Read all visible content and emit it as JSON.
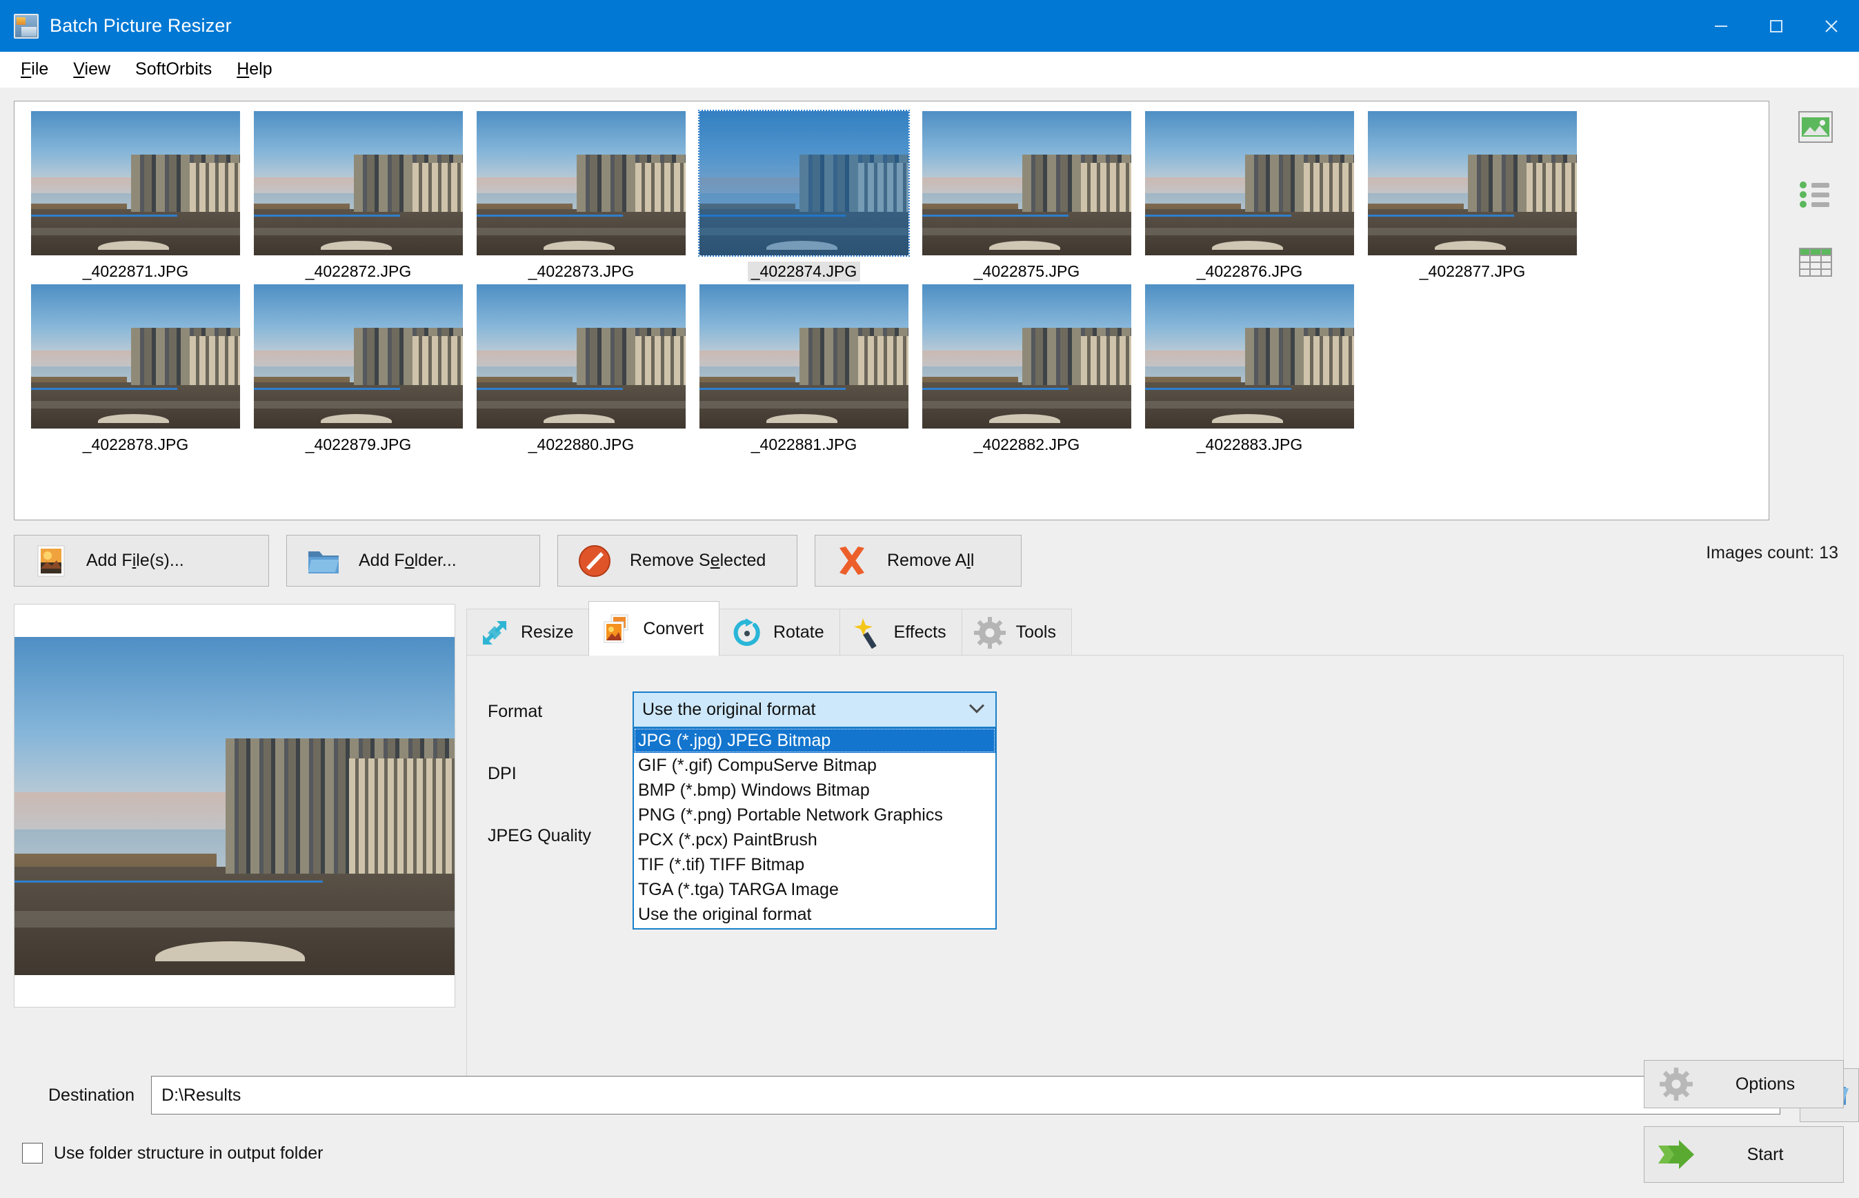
{
  "window": {
    "title": "Batch Picture Resizer",
    "icon": "app-picture-icon",
    "minimize": "–",
    "maximize": "□",
    "close": "✕",
    "titlebar_color": "#0078d4"
  },
  "menu": {
    "items": [
      {
        "label": "File",
        "accel": "F"
      },
      {
        "label": "View",
        "accel": "V"
      },
      {
        "label": "SoftOrbits",
        "accel": ""
      },
      {
        "label": "Help",
        "accel": "H"
      }
    ]
  },
  "thumbnails": {
    "selected_index": 3,
    "items": [
      {
        "filename": "_4022871.JPG"
      },
      {
        "filename": "_4022872.JPG"
      },
      {
        "filename": "_4022873.JPG"
      },
      {
        "filename": "_4022874.JPG"
      },
      {
        "filename": "_4022875.JPG"
      },
      {
        "filename": "_4022876.JPG"
      },
      {
        "filename": "_4022877.JPG"
      },
      {
        "filename": "_4022878.JPG"
      },
      {
        "filename": "_4022879.JPG"
      },
      {
        "filename": "_4022880.JPG"
      },
      {
        "filename": "_4022881.JPG"
      },
      {
        "filename": "_4022882.JPG"
      },
      {
        "filename": "_4022883.JPG"
      }
    ]
  },
  "view_modes": [
    {
      "name": "thumbnail-view-icon"
    },
    {
      "name": "list-view-icon"
    },
    {
      "name": "details-view-icon"
    }
  ],
  "actions": {
    "add_files": "Add File(s)...",
    "add_folder": "Add Folder...",
    "remove_selected": "Remove Selected",
    "remove_all": "Remove All",
    "images_count": "Images count: 13"
  },
  "tabs": [
    {
      "label": "Resize",
      "icon": "resize-arrows-icon",
      "active": false
    },
    {
      "label": "Convert",
      "icon": "convert-image-icon",
      "active": true
    },
    {
      "label": "Rotate",
      "icon": "rotate-circular-arrow-icon",
      "active": false
    },
    {
      "label": "Effects",
      "icon": "magic-wand-icon",
      "active": false
    },
    {
      "label": "Tools",
      "icon": "gear-icon",
      "active": false
    }
  ],
  "convert_panel": {
    "format_label": "Format",
    "dpi_label": "DPI",
    "jpeg_quality_label": "JPEG Quality",
    "format_value": "Use the original format",
    "format_options": [
      "JPG (*.jpg) JPEG Bitmap",
      "GIF (*.gif) CompuServe Bitmap",
      "BMP (*.bmp) Windows Bitmap",
      "PNG (*.png) Portable Network Graphics",
      "PCX (*.pcx) PaintBrush",
      "TIF (*.tif) TIFF Bitmap",
      "TGA (*.tga) TARGA Image",
      "Use the original format"
    ],
    "highlighted_option_index": 0,
    "dropdown_open": true,
    "accent_color": "#1375ce",
    "combo_fill": "#cde8fa"
  },
  "destination": {
    "label": "Destination",
    "value": "D:\\Results",
    "browse_icon": "open-folder-icon"
  },
  "checkbox": {
    "label": "Use folder structure in output folder",
    "checked": false
  },
  "bottom_buttons": {
    "options": "Options",
    "start": "Start"
  }
}
